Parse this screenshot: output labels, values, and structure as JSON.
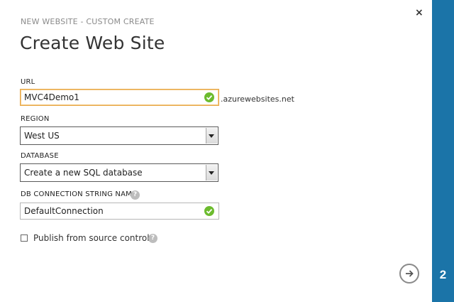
{
  "dialog": {
    "subtitle": "NEW WEBSITE - CUSTOM CREATE",
    "title": "Create Web Site",
    "close_glyph": "×",
    "step": "2",
    "accent_color": "#1b74a8"
  },
  "form": {
    "url": {
      "label": "URL",
      "value": "MVC4Demo1",
      "suffix": ".azurewebsites.net",
      "status_icon": "check-circle-icon"
    },
    "region": {
      "label": "REGION",
      "selected": "West US"
    },
    "database": {
      "label": "DATABASE",
      "selected": "Create a new SQL database"
    },
    "db_connection": {
      "label": "DB CONNECTION STRING NAME",
      "help_glyph": "?",
      "value": "DefaultConnection",
      "status_icon": "check-circle-icon"
    },
    "publish": {
      "label": "Publish from source control",
      "checked": false,
      "help_glyph": "?"
    }
  },
  "footer": {
    "next_icon": "arrow-right-icon"
  }
}
